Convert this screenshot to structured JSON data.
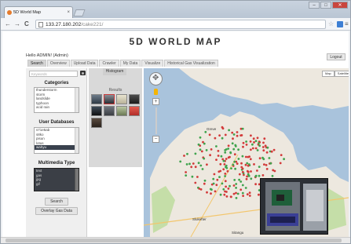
{
  "browser": {
    "tab_title": "5D World Map",
    "tab_close": "×",
    "url_host": "133.27.180.202",
    "url_path": "/cake221/",
    "back": "←",
    "forward": "→",
    "reload": "C",
    "star": "☆",
    "menu": "≡",
    "window_minimize": "–",
    "window_maximize": "□",
    "window_close": "✕"
  },
  "header": {
    "title": "5D WORLD MAP",
    "greeting": "Hello ADMIN! (Admin)",
    "logout_label": "Logout"
  },
  "nav": {
    "tabs": [
      "Search",
      "Overview",
      "Upload Data",
      "Crawler",
      "My Data",
      "Visualize",
      "Historical Gas Visualization"
    ],
    "active": 0
  },
  "sidebar": {
    "keyword_placeholder": "Keywords",
    "categories_heading": "Categories",
    "categories": [
      "thunderstorm",
      "storm",
      "landslide",
      "typhoon",
      "acid rain"
    ],
    "user_db_heading": "User Databases",
    "user_dbs": [
      "s71e5ab",
      "s8ko",
      "pisun",
      "lotus",
      "wahyu"
    ],
    "user_db_selected": 4,
    "multimedia_heading": "Multimedia Type",
    "multimedia_types": [
      "text",
      "gas",
      "jpg",
      "gif"
    ],
    "search_label": "Search",
    "overlay_label": "Overlay Gas Data"
  },
  "results": {
    "histogram_tab": "Histogram",
    "label": "Results"
  },
  "map": {
    "type_map": "Map",
    "type_satellite": "Satellite",
    "zoom_in": "+",
    "zoom_out": "−",
    "places": [
      "Greve",
      "Slukefter",
      "Sitangu"
    ],
    "colors": {
      "water": "#a9c3dc",
      "land": "#ede8df",
      "park": "#c5dea8",
      "marker_red": "#d23a3a",
      "marker_green": "#3fa34d"
    }
  }
}
